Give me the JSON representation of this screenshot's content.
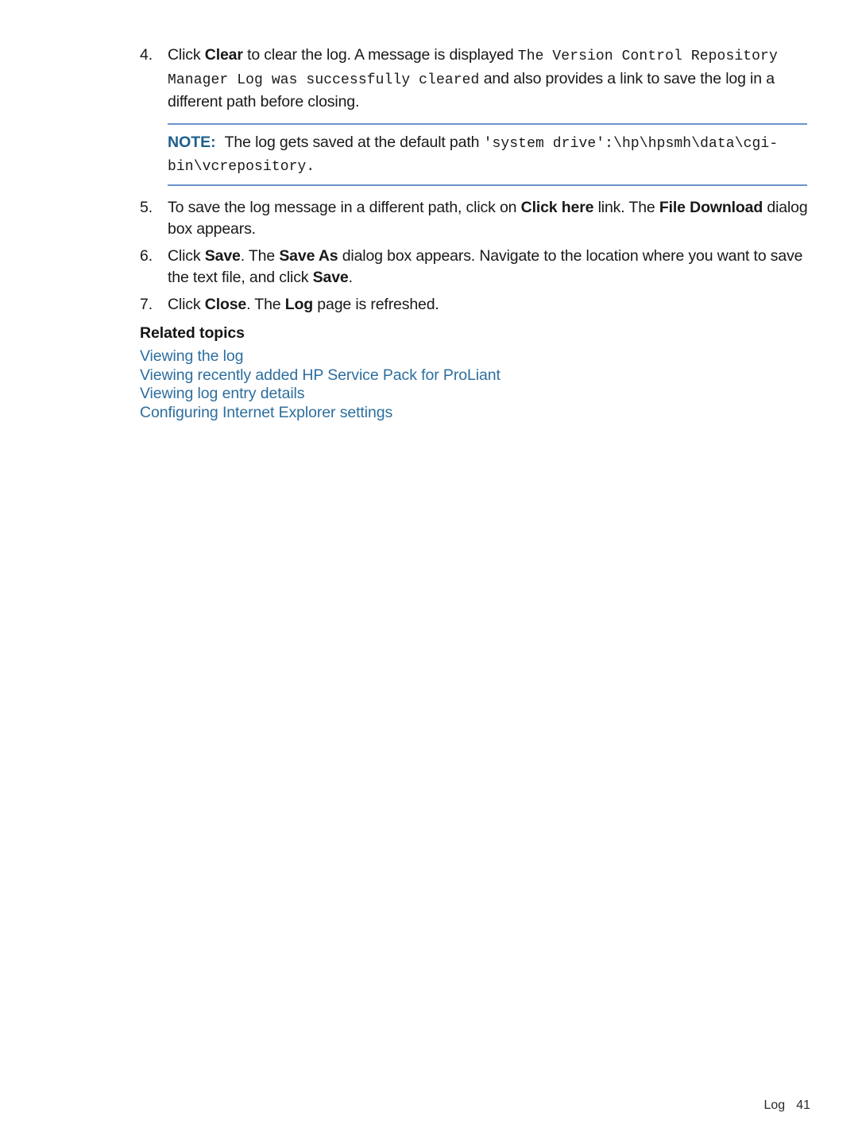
{
  "document": {
    "steps": [
      {
        "number": "4.",
        "segments": [
          {
            "type": "text",
            "text": "Click "
          },
          {
            "type": "bold",
            "text": "Clear"
          },
          {
            "type": "text",
            "text": " to clear the log. A message is displayed "
          },
          {
            "type": "mono",
            "text": "The Version Control Repository Manager Log was successfully cleared"
          },
          {
            "type": "text",
            "text": " and also provides a link to save the log in a different path before closing."
          }
        ]
      },
      {
        "number": "5.",
        "segments": [
          {
            "type": "text",
            "text": "To save the log message in a different path, click on "
          },
          {
            "type": "bold",
            "text": "Click here"
          },
          {
            "type": "text",
            "text": " link. The "
          },
          {
            "type": "bold",
            "text": "File Download"
          },
          {
            "type": "text",
            "text": " dialog box appears."
          }
        ]
      },
      {
        "number": "6.",
        "segments": [
          {
            "type": "text",
            "text": "Click "
          },
          {
            "type": "bold",
            "text": "Save"
          },
          {
            "type": "text",
            "text": ". The "
          },
          {
            "type": "bold",
            "text": "Save As"
          },
          {
            "type": "text",
            "text": " dialog box appears. Navigate to the location where you want to save the text file, and click "
          },
          {
            "type": "bold",
            "text": "Save"
          },
          {
            "type": "text",
            "text": "."
          }
        ]
      },
      {
        "number": "7.",
        "segments": [
          {
            "type": "text",
            "text": "Click "
          },
          {
            "type": "bold",
            "text": "Close"
          },
          {
            "type": "text",
            "text": ". The "
          },
          {
            "type": "bold",
            "text": "Log"
          },
          {
            "type": "text",
            "text": " page is refreshed."
          }
        ]
      }
    ],
    "note": {
      "label": "NOTE:",
      "text": "The log gets saved at the default path ",
      "path": "'system drive':\\hp\\hpsmh\\data\\cgi-bin\\vcrepository."
    },
    "related_topics": {
      "heading": "Related topics",
      "links": [
        "Viewing the log",
        "Viewing recently added HP Service Pack for ProLiant",
        "Viewing log entry details",
        "Configuring Internet Explorer settings"
      ]
    },
    "footer": {
      "label": "Log",
      "page_number": "41"
    },
    "colors": {
      "link": "#2d6e9e",
      "note_label": "#1c5f8c",
      "rule": "#6a93c8",
      "body_text": "#191919"
    }
  }
}
